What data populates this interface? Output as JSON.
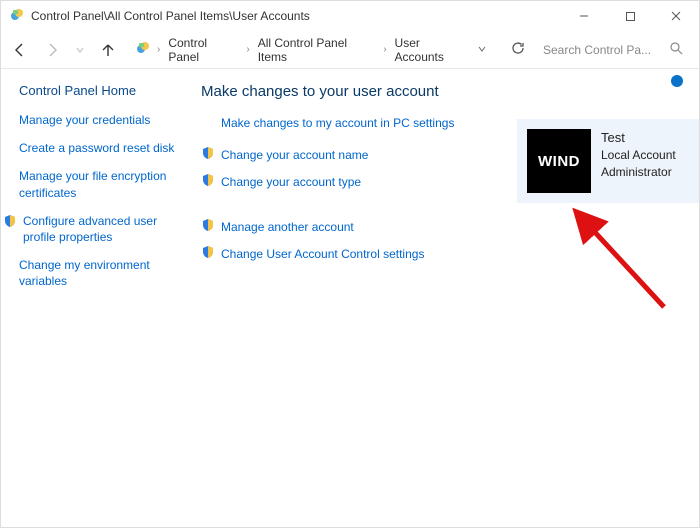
{
  "window": {
    "title": "Control Panel\\All Control Panel Items\\User Accounts"
  },
  "breadcrumb": {
    "items": [
      "Control Panel",
      "All Control Panel Items",
      "User Accounts"
    ]
  },
  "search": {
    "placeholder": "Search Control Pa..."
  },
  "sidebar": {
    "home": "Control Panel Home",
    "links": [
      {
        "label": "Manage your credentials",
        "shield": false
      },
      {
        "label": "Create a password reset disk",
        "shield": false
      },
      {
        "label": "Manage your file encryption certificates",
        "shield": false
      },
      {
        "label": "Configure advanced user profile properties",
        "shield": true
      },
      {
        "label": "Change my environment variables",
        "shield": false
      }
    ]
  },
  "main": {
    "heading": "Make changes to your user account",
    "pc_settings_link": "Make changes to my account in PC settings",
    "actions_group1": [
      "Change your account name",
      "Change your account type"
    ],
    "actions_group2": [
      "Manage another account",
      "Change User Account Control settings"
    ]
  },
  "account": {
    "avatar_text": "WIND",
    "name": "Test",
    "type": "Local Account",
    "role": "Administrator"
  }
}
